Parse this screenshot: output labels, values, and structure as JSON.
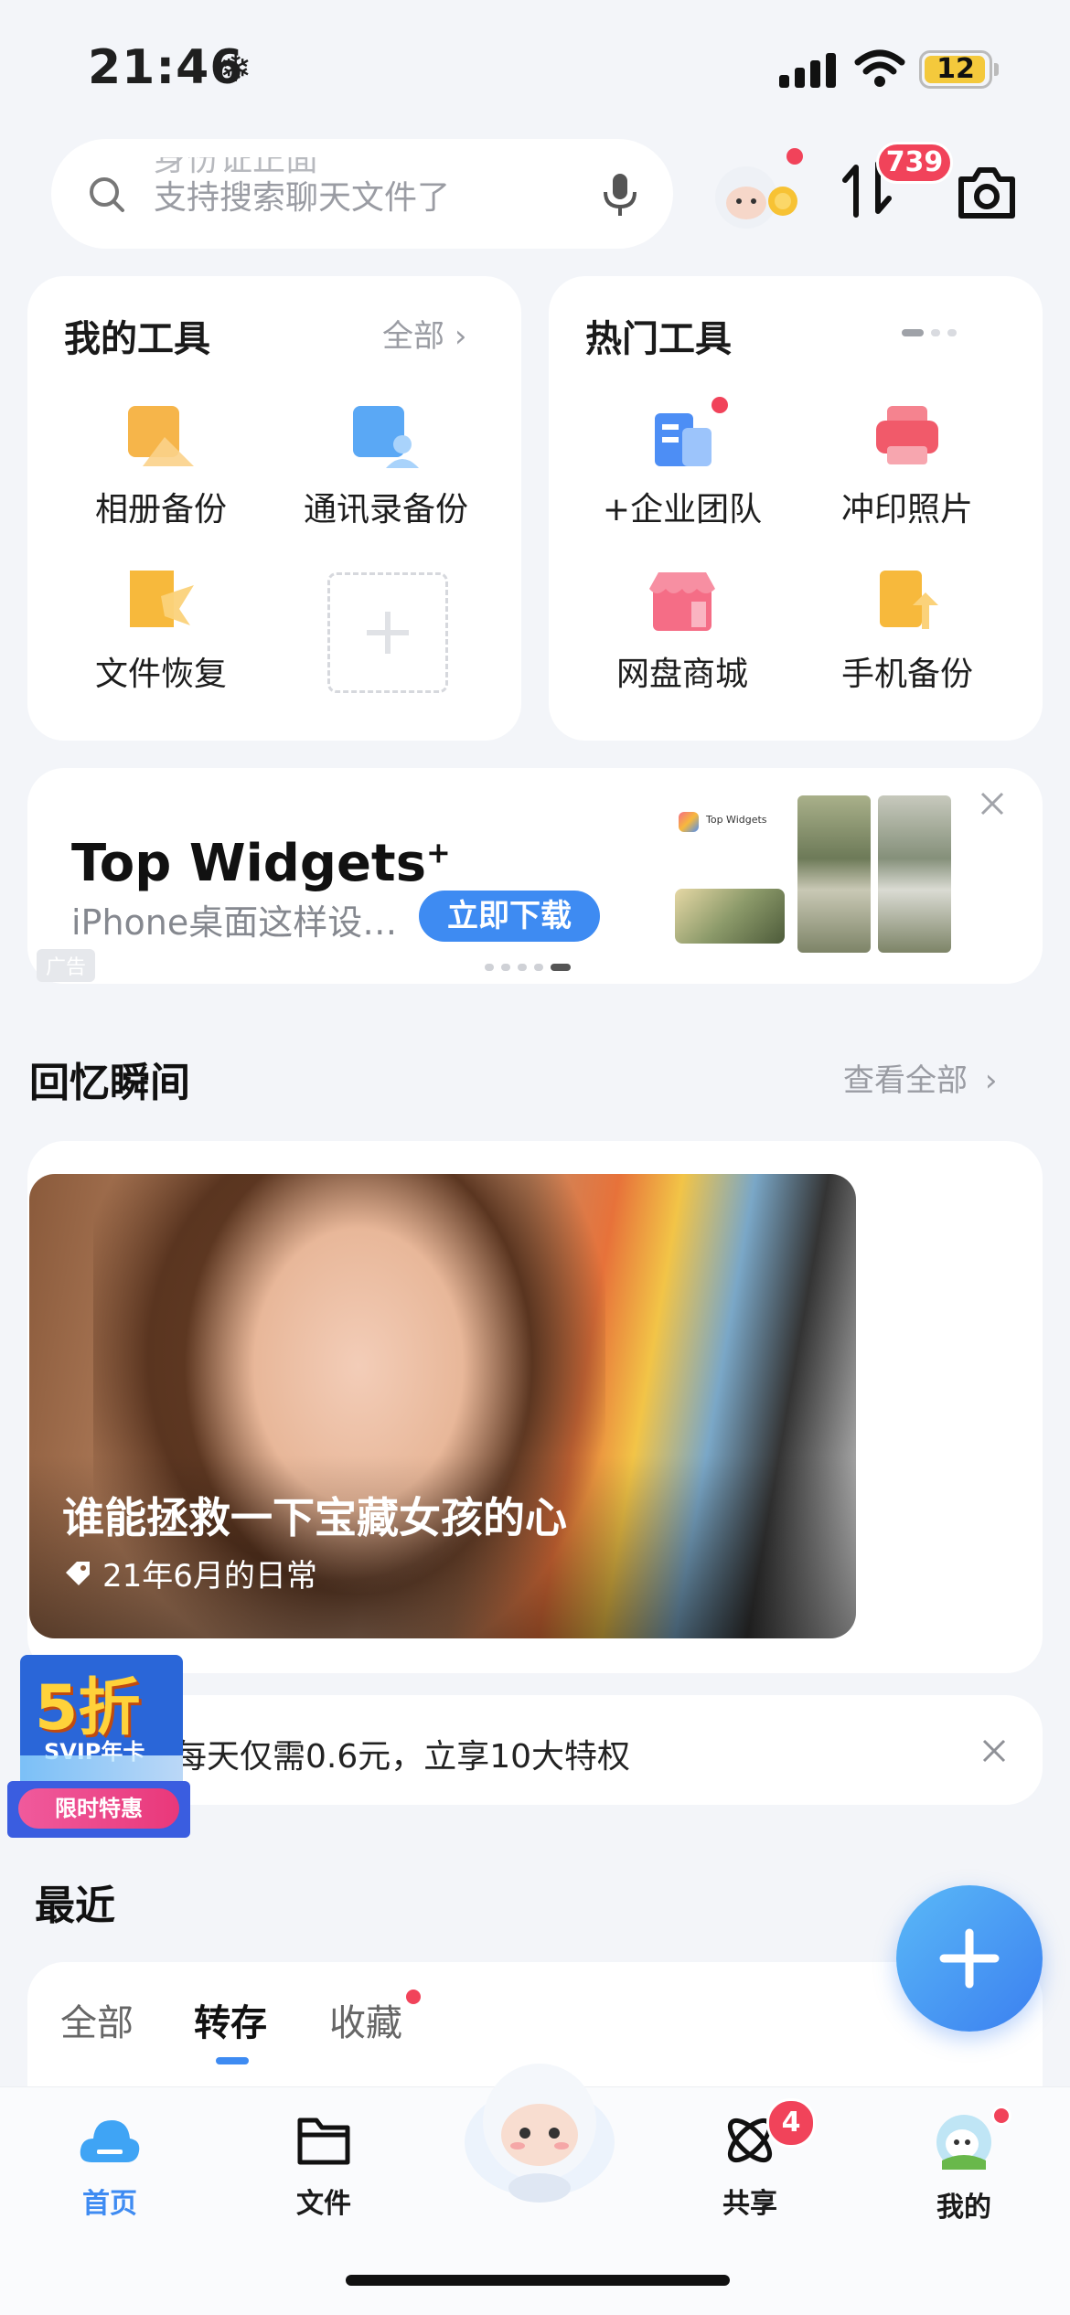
{
  "status_bar": {
    "time": "21:46",
    "weather_icon": "snowflake-icon",
    "battery": "12"
  },
  "search": {
    "placeholder_line1": "身份证正面",
    "placeholder_line2": "支持搜索聊天文件了"
  },
  "transfer": {
    "badge": "739"
  },
  "my_tools": {
    "title": "我的工具",
    "all_link": "全部",
    "items": [
      {
        "label": "相册备份",
        "icon": "photo-backup-icon",
        "color": "#f6b54a"
      },
      {
        "label": "通讯录备份",
        "icon": "contacts-backup-icon",
        "color": "#5aa8f5"
      },
      {
        "label": "文件恢复",
        "icon": "file-restore-icon",
        "color": "#f7b93c"
      }
    ]
  },
  "hot_tools": {
    "title": "热门工具",
    "items": [
      {
        "label": "+企业团队",
        "icon": "enterprise-team-icon",
        "color": "#4d8ef5"
      },
      {
        "label": "冲印照片",
        "icon": "print-photos-icon",
        "color": "#f15a6a"
      },
      {
        "label": "网盘商城",
        "icon": "store-icon",
        "color": "#f56d86"
      },
      {
        "label": "手机备份",
        "icon": "phone-backup-icon",
        "color": "#f7b93c"
      }
    ]
  },
  "ad": {
    "title": "Top Widgets",
    "title_mark": "+",
    "subtitle": "iPhone桌面这样设…",
    "button": "立即下载",
    "tag": "广告"
  },
  "memories": {
    "title": "回忆瞬间",
    "view_all": "查看全部",
    "card_title": "谁能拯救一下宝藏女孩的心",
    "card_sub": "21年6月的日常"
  },
  "promo": {
    "text": "每天仅需0.6元，立享10大特权",
    "sticker_big": "5折",
    "sticker_mid": "SVIP年卡",
    "sticker_btn": "限时特惠"
  },
  "recent": {
    "title": "最近",
    "tabs": [
      "全部",
      "转存",
      "收藏"
    ],
    "active_tab": "转存"
  },
  "bottom_nav": [
    {
      "label": "首页",
      "icon": "home-cloud-icon"
    },
    {
      "label": "文件",
      "icon": "folder-icon"
    },
    {
      "label": "",
      "icon": "mascot-icon"
    },
    {
      "label": "共享",
      "icon": "share-atom-icon",
      "badge": "4"
    },
    {
      "label": "我的",
      "icon": "profile-avatar-icon"
    }
  ],
  "colors": {
    "accent": "#3e8bf2",
    "badge_red": "#f1435a",
    "background": "#f3f5f9"
  }
}
